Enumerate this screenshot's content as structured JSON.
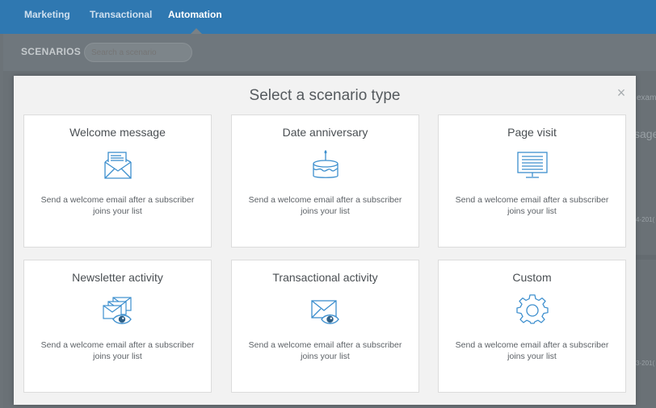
{
  "topnav": {
    "tabs": [
      {
        "label": "Marketing"
      },
      {
        "label": "Transactional"
      },
      {
        "label": "Automation"
      }
    ]
  },
  "subbar": {
    "section_label": "SCENARIOS",
    "search_placeholder": "Search a scenario"
  },
  "background_peek": {
    "text_1": "exam",
    "text_2": "sage",
    "text_3": "4-201(",
    "text_4": "3-201("
  },
  "modal": {
    "title": "Select a scenario type",
    "close_glyph": "×",
    "cards": [
      {
        "title": "Welcome message",
        "desc": "Send a welcome email after a subscriber joins your list",
        "icon": "envelope-letter-icon"
      },
      {
        "title": "Date anniversary",
        "desc": "Send a welcome email after a subscriber joins your list",
        "icon": "birthday-cake-icon"
      },
      {
        "title": "Page visit",
        "desc": "Send a welcome email after a subscriber joins your list",
        "icon": "monitor-icon"
      },
      {
        "title": "Newsletter activity",
        "desc": "Send a welcome email after a subscriber joins your list",
        "icon": "envelopes-eye-icon"
      },
      {
        "title": "Transactional activity",
        "desc": "Send a welcome email after a subscriber joins your list",
        "icon": "envelope-eye-icon"
      },
      {
        "title": "Custom",
        "desc": "Send a welcome email after a subscriber joins your list",
        "icon": "gear-icon"
      }
    ]
  },
  "colors": {
    "nav_bg": "#2f78b1",
    "icon_blue": "#3d8fce",
    "modal_bg": "#f2f2f2"
  }
}
